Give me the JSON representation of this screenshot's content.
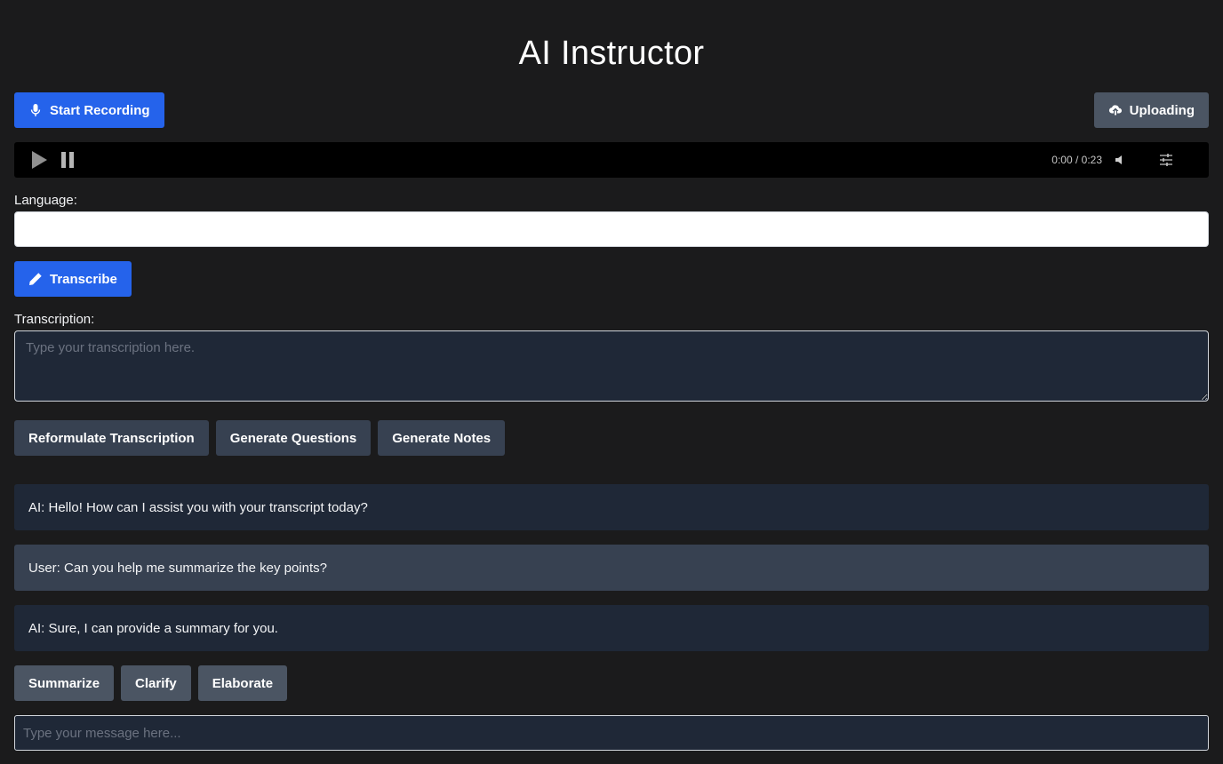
{
  "app": {
    "title": "AI Instructor"
  },
  "toolbar": {
    "record_label": "Start Recording",
    "record_icon": "microphone-icon",
    "upload_label": "Uploading",
    "upload_icon": "cloud-upload-icon"
  },
  "player": {
    "time": "0:00 / 0:23",
    "icons": [
      "play-icon",
      "pause-icon",
      "volume-icon",
      "sliders-icon"
    ]
  },
  "language": {
    "label": "Language:",
    "value": ""
  },
  "transcribe": {
    "label": "Transcribe",
    "icon": "pencil-icon"
  },
  "transcription": {
    "label": "Transcription:",
    "placeholder": "Type your transcription here.",
    "value": ""
  },
  "actions": [
    {
      "label": "Reformulate Transcription"
    },
    {
      "label": "Generate Questions"
    },
    {
      "label": "Generate Notes"
    }
  ],
  "chat": {
    "messages": [
      {
        "role": "ai",
        "text": "AI: Hello! How can I assist you with your transcript today?"
      },
      {
        "role": "user",
        "text": "User: Can you help me summarize the key points?"
      },
      {
        "role": "ai",
        "text": "AI: Sure, I can provide a summary for you."
      }
    ],
    "quick_actions": [
      {
        "label": "Summarize"
      },
      {
        "label": "Clarify"
      },
      {
        "label": "Elaborate"
      }
    ],
    "input_placeholder": "Type your message here..."
  },
  "colors": {
    "background": "#1b1b1c",
    "primary": "#2563eb",
    "secondary": "#4b5563",
    "slate": "#374151",
    "panel": "#1f2837"
  }
}
